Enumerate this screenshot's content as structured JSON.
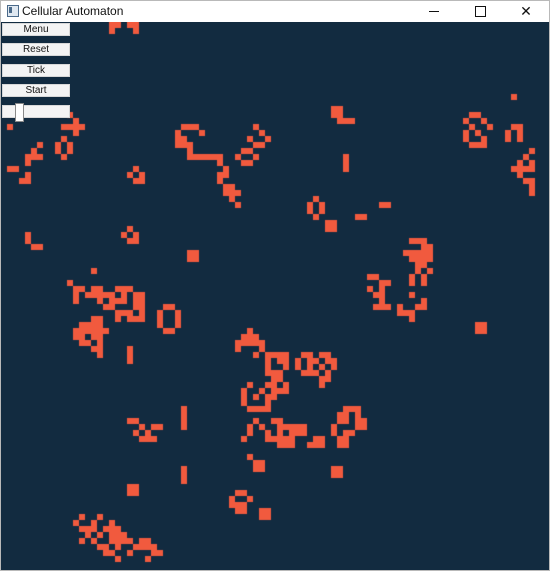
{
  "window": {
    "title": "Cellular Automaton",
    "minimize_icon": "minimize-icon",
    "maximize_icon": "maximize-icon",
    "close_icon": "close-icon",
    "close_glyph": "✕"
  },
  "controls": {
    "menu_label": "Menu",
    "reset_label": "Reset",
    "tick_label": "Tick",
    "start_label": "Start",
    "speed_value": 0.2
  },
  "colors": {
    "background": "#122b40",
    "cell": "#f15a3e"
  },
  "grid": {
    "cell_size_px": 6,
    "live_cells": [
      [
        18,
        0
      ],
      [
        19,
        0
      ],
      [
        21,
        0
      ],
      [
        22,
        0
      ],
      [
        18,
        1
      ],
      [
        22,
        1
      ],
      [
        85,
        12
      ],
      [
        55,
        14
      ],
      [
        56,
        14
      ],
      [
        55,
        15
      ],
      [
        56,
        15
      ],
      [
        56,
        16
      ],
      [
        57,
        16
      ],
      [
        58,
        16
      ],
      [
        1,
        17
      ],
      [
        11,
        15
      ],
      [
        12,
        16
      ],
      [
        10,
        17
      ],
      [
        11,
        17
      ],
      [
        12,
        17
      ],
      [
        13,
        17
      ],
      [
        12,
        18
      ],
      [
        10,
        19
      ],
      [
        9,
        20
      ],
      [
        11,
        20
      ],
      [
        9,
        21
      ],
      [
        11,
        21
      ],
      [
        10,
        22
      ],
      [
        78,
        15
      ],
      [
        79,
        15
      ],
      [
        77,
        16
      ],
      [
        80,
        16
      ],
      [
        78,
        17
      ],
      [
        81,
        17
      ],
      [
        77,
        18
      ],
      [
        79,
        18
      ],
      [
        77,
        19
      ],
      [
        80,
        19
      ],
      [
        78,
        20
      ],
      [
        79,
        20
      ],
      [
        80,
        20
      ],
      [
        85,
        17
      ],
      [
        86,
        17
      ],
      [
        84,
        18
      ],
      [
        86,
        18
      ],
      [
        84,
        19
      ],
      [
        86,
        19
      ],
      [
        30,
        17
      ],
      [
        31,
        17
      ],
      [
        32,
        17
      ],
      [
        29,
        18
      ],
      [
        33,
        18
      ],
      [
        29,
        19
      ],
      [
        30,
        19
      ],
      [
        29,
        20
      ],
      [
        30,
        20
      ],
      [
        31,
        20
      ],
      [
        31,
        21
      ],
      [
        31,
        22
      ],
      [
        32,
        22
      ],
      [
        33,
        22
      ],
      [
        34,
        22
      ],
      [
        35,
        22
      ],
      [
        36,
        22
      ],
      [
        36,
        23
      ],
      [
        37,
        24
      ],
      [
        36,
        25
      ],
      [
        37,
        25
      ],
      [
        36,
        26
      ],
      [
        37,
        27
      ],
      [
        38,
        27
      ],
      [
        37,
        28
      ],
      [
        38,
        28
      ],
      [
        39,
        28
      ],
      [
        38,
        29
      ],
      [
        39,
        30
      ],
      [
        42,
        17
      ],
      [
        43,
        18
      ],
      [
        41,
        19
      ],
      [
        44,
        19
      ],
      [
        42,
        20
      ],
      [
        43,
        20
      ],
      [
        40,
        21
      ],
      [
        41,
        21
      ],
      [
        39,
        22
      ],
      [
        42,
        22
      ],
      [
        40,
        23
      ],
      [
        41,
        23
      ],
      [
        6,
        20
      ],
      [
        5,
        21
      ],
      [
        4,
        22
      ],
      [
        5,
        22
      ],
      [
        6,
        22
      ],
      [
        4,
        23
      ],
      [
        1,
        24
      ],
      [
        2,
        24
      ],
      [
        4,
        25
      ],
      [
        3,
        26
      ],
      [
        4,
        26
      ],
      [
        57,
        22
      ],
      [
        57,
        23
      ],
      [
        57,
        24
      ],
      [
        88,
        21
      ],
      [
        87,
        22
      ],
      [
        86,
        23
      ],
      [
        88,
        23
      ],
      [
        85,
        24
      ],
      [
        86,
        24
      ],
      [
        87,
        24
      ],
      [
        88,
        24
      ],
      [
        86,
        25
      ],
      [
        87,
        26
      ],
      [
        88,
        26
      ],
      [
        88,
        27
      ],
      [
        88,
        28
      ],
      [
        22,
        24
      ],
      [
        21,
        25
      ],
      [
        23,
        25
      ],
      [
        22,
        26
      ],
      [
        23,
        26
      ],
      [
        52,
        29
      ],
      [
        51,
        30
      ],
      [
        53,
        30
      ],
      [
        51,
        31
      ],
      [
        53,
        31
      ],
      [
        52,
        32
      ],
      [
        63,
        30
      ],
      [
        64,
        30
      ],
      [
        59,
        32
      ],
      [
        60,
        32
      ],
      [
        54,
        33
      ],
      [
        55,
        33
      ],
      [
        54,
        34
      ],
      [
        55,
        34
      ],
      [
        4,
        35
      ],
      [
        4,
        36
      ],
      [
        5,
        37
      ],
      [
        6,
        37
      ],
      [
        21,
        34
      ],
      [
        20,
        35
      ],
      [
        22,
        35
      ],
      [
        21,
        36
      ],
      [
        22,
        36
      ],
      [
        31,
        38
      ],
      [
        32,
        38
      ],
      [
        31,
        39
      ],
      [
        32,
        39
      ],
      [
        68,
        36
      ],
      [
        69,
        36
      ],
      [
        70,
        36
      ],
      [
        70,
        37
      ],
      [
        71,
        37
      ],
      [
        67,
        38
      ],
      [
        68,
        38
      ],
      [
        69,
        38
      ],
      [
        70,
        38
      ],
      [
        71,
        38
      ],
      [
        68,
        39
      ],
      [
        69,
        39
      ],
      [
        70,
        39
      ],
      [
        71,
        39
      ],
      [
        69,
        40
      ],
      [
        70,
        40
      ],
      [
        69,
        41
      ],
      [
        71,
        41
      ],
      [
        68,
        42
      ],
      [
        70,
        42
      ],
      [
        68,
        43
      ],
      [
        70,
        43
      ],
      [
        15,
        41
      ],
      [
        11,
        43
      ],
      [
        12,
        44
      ],
      [
        13,
        44
      ],
      [
        15,
        44
      ],
      [
        16,
        44
      ],
      [
        19,
        44
      ],
      [
        20,
        44
      ],
      [
        21,
        44
      ],
      [
        12,
        45
      ],
      [
        14,
        45
      ],
      [
        15,
        45
      ],
      [
        16,
        45
      ],
      [
        17,
        45
      ],
      [
        18,
        45
      ],
      [
        20,
        45
      ],
      [
        22,
        45
      ],
      [
        23,
        45
      ],
      [
        12,
        46
      ],
      [
        16,
        46
      ],
      [
        18,
        46
      ],
      [
        19,
        46
      ],
      [
        20,
        46
      ],
      [
        22,
        46
      ],
      [
        23,
        46
      ],
      [
        17,
        47
      ],
      [
        18,
        47
      ],
      [
        22,
        47
      ],
      [
        23,
        47
      ],
      [
        27,
        47
      ],
      [
        28,
        47
      ],
      [
        19,
        48
      ],
      [
        20,
        48
      ],
      [
        21,
        48
      ],
      [
        23,
        48
      ],
      [
        26,
        48
      ],
      [
        29,
        48
      ],
      [
        15,
        49
      ],
      [
        16,
        49
      ],
      [
        19,
        49
      ],
      [
        21,
        49
      ],
      [
        22,
        49
      ],
      [
        23,
        49
      ],
      [
        26,
        49
      ],
      [
        29,
        49
      ],
      [
        13,
        50
      ],
      [
        14,
        50
      ],
      [
        15,
        50
      ],
      [
        16,
        50
      ],
      [
        26,
        50
      ],
      [
        29,
        50
      ],
      [
        12,
        51
      ],
      [
        13,
        51
      ],
      [
        14,
        51
      ],
      [
        15,
        51
      ],
      [
        16,
        51
      ],
      [
        17,
        51
      ],
      [
        27,
        51
      ],
      [
        28,
        51
      ],
      [
        12,
        52
      ],
      [
        13,
        52
      ],
      [
        15,
        52
      ],
      [
        16,
        52
      ],
      [
        13,
        53
      ],
      [
        14,
        53
      ],
      [
        16,
        53
      ],
      [
        15,
        54
      ],
      [
        16,
        54
      ],
      [
        16,
        55
      ],
      [
        61,
        42
      ],
      [
        62,
        42
      ],
      [
        63,
        43
      ],
      [
        64,
        43
      ],
      [
        61,
        44
      ],
      [
        63,
        44
      ],
      [
        62,
        45
      ],
      [
        63,
        45
      ],
      [
        63,
        46
      ],
      [
        62,
        47
      ],
      [
        63,
        47
      ],
      [
        64,
        47
      ],
      [
        66,
        47
      ],
      [
        66,
        48
      ],
      [
        67,
        48
      ],
      [
        68,
        48
      ],
      [
        68,
        49
      ],
      [
        68,
        45
      ],
      [
        70,
        46
      ],
      [
        69,
        47
      ],
      [
        70,
        47
      ],
      [
        21,
        54
      ],
      [
        21,
        55
      ],
      [
        21,
        56
      ],
      [
        79,
        50
      ],
      [
        80,
        50
      ],
      [
        79,
        51
      ],
      [
        80,
        51
      ],
      [
        41,
        51
      ],
      [
        40,
        52
      ],
      [
        41,
        52
      ],
      [
        42,
        52
      ],
      [
        39,
        53
      ],
      [
        40,
        53
      ],
      [
        41,
        53
      ],
      [
        42,
        53
      ],
      [
        43,
        53
      ],
      [
        39,
        54
      ],
      [
        43,
        54
      ],
      [
        42,
        55
      ],
      [
        44,
        55
      ],
      [
        45,
        55
      ],
      [
        46,
        55
      ],
      [
        47,
        55
      ],
      [
        44,
        56
      ],
      [
        46,
        56
      ],
      [
        47,
        56
      ],
      [
        44,
        57
      ],
      [
        47,
        57
      ],
      [
        44,
        58
      ],
      [
        45,
        58
      ],
      [
        46,
        58
      ],
      [
        45,
        59
      ],
      [
        46,
        59
      ],
      [
        45,
        60
      ],
      [
        47,
        60
      ],
      [
        46,
        61
      ],
      [
        47,
        61
      ],
      [
        50,
        55
      ],
      [
        51,
        55
      ],
      [
        53,
        55
      ],
      [
        54,
        55
      ],
      [
        49,
        56
      ],
      [
        51,
        56
      ],
      [
        52,
        56
      ],
      [
        54,
        56
      ],
      [
        55,
        56
      ],
      [
        49,
        57
      ],
      [
        51,
        57
      ],
      [
        53,
        57
      ],
      [
        55,
        57
      ],
      [
        50,
        58
      ],
      [
        51,
        58
      ],
      [
        52,
        58
      ],
      [
        54,
        58
      ],
      [
        53,
        59
      ],
      [
        54,
        59
      ],
      [
        53,
        60
      ],
      [
        41,
        60
      ],
      [
        44,
        60
      ],
      [
        40,
        61
      ],
      [
        43,
        61
      ],
      [
        45,
        61
      ],
      [
        40,
        62
      ],
      [
        42,
        62
      ],
      [
        44,
        62
      ],
      [
        45,
        62
      ],
      [
        40,
        63
      ],
      [
        44,
        63
      ],
      [
        41,
        64
      ],
      [
        42,
        64
      ],
      [
        43,
        64
      ],
      [
        44,
        64
      ],
      [
        30,
        64
      ],
      [
        30,
        65
      ],
      [
        30,
        66
      ],
      [
        30,
        67
      ],
      [
        57,
        64
      ],
      [
        58,
        64
      ],
      [
        59,
        64
      ],
      [
        56,
        65
      ],
      [
        57,
        65
      ],
      [
        59,
        65
      ],
      [
        56,
        66
      ],
      [
        57,
        66
      ],
      [
        59,
        66
      ],
      [
        60,
        66
      ],
      [
        55,
        67
      ],
      [
        59,
        67
      ],
      [
        60,
        67
      ],
      [
        55,
        68
      ],
      [
        57,
        68
      ],
      [
        58,
        68
      ],
      [
        56,
        69
      ],
      [
        57,
        69
      ],
      [
        56,
        70
      ],
      [
        57,
        70
      ],
      [
        48,
        67
      ],
      [
        49,
        67
      ],
      [
        50,
        67
      ],
      [
        48,
        68
      ],
      [
        49,
        68
      ],
      [
        50,
        68
      ],
      [
        52,
        69
      ],
      [
        53,
        69
      ],
      [
        51,
        70
      ],
      [
        52,
        70
      ],
      [
        53,
        70
      ],
      [
        21,
        66
      ],
      [
        22,
        66
      ],
      [
        23,
        67
      ],
      [
        25,
        67
      ],
      [
        26,
        67
      ],
      [
        22,
        68
      ],
      [
        24,
        68
      ],
      [
        23,
        69
      ],
      [
        24,
        69
      ],
      [
        25,
        69
      ],
      [
        42,
        66
      ],
      [
        45,
        66
      ],
      [
        46,
        66
      ],
      [
        41,
        67
      ],
      [
        43,
        67
      ],
      [
        46,
        67
      ],
      [
        47,
        67
      ],
      [
        41,
        68
      ],
      [
        44,
        68
      ],
      [
        46,
        68
      ],
      [
        48,
        68
      ],
      [
        40,
        69
      ],
      [
        44,
        69
      ],
      [
        45,
        69
      ],
      [
        46,
        69
      ],
      [
        47,
        69
      ],
      [
        48,
        69
      ],
      [
        46,
        70
      ],
      [
        47,
        70
      ],
      [
        48,
        70
      ],
      [
        41,
        72
      ],
      [
        42,
        73
      ],
      [
        43,
        73
      ],
      [
        42,
        74
      ],
      [
        43,
        74
      ],
      [
        30,
        74
      ],
      [
        30,
        75
      ],
      [
        30,
        76
      ],
      [
        21,
        77
      ],
      [
        22,
        77
      ],
      [
        21,
        78
      ],
      [
        22,
        78
      ],
      [
        39,
        78
      ],
      [
        40,
        78
      ],
      [
        38,
        79
      ],
      [
        41,
        79
      ],
      [
        38,
        80
      ],
      [
        39,
        80
      ],
      [
        40,
        80
      ],
      [
        39,
        81
      ],
      [
        40,
        81
      ],
      [
        43,
        81
      ],
      [
        44,
        81
      ],
      [
        43,
        82
      ],
      [
        44,
        82
      ],
      [
        55,
        74
      ],
      [
        56,
        74
      ],
      [
        55,
        75
      ],
      [
        56,
        75
      ],
      [
        13,
        82
      ],
      [
        16,
        82
      ],
      [
        18,
        83
      ],
      [
        12,
        83
      ],
      [
        15,
        83
      ],
      [
        13,
        84
      ],
      [
        14,
        84
      ],
      [
        15,
        84
      ],
      [
        17,
        84
      ],
      [
        18,
        84
      ],
      [
        19,
        84
      ],
      [
        14,
        85
      ],
      [
        16,
        85
      ],
      [
        18,
        85
      ],
      [
        19,
        85
      ],
      [
        20,
        85
      ],
      [
        13,
        86
      ],
      [
        15,
        86
      ],
      [
        18,
        86
      ],
      [
        19,
        86
      ],
      [
        20,
        86
      ],
      [
        21,
        86
      ],
      [
        23,
        86
      ],
      [
        24,
        86
      ],
      [
        16,
        87
      ],
      [
        17,
        87
      ],
      [
        19,
        87
      ],
      [
        22,
        87
      ],
      [
        23,
        87
      ],
      [
        24,
        87
      ],
      [
        25,
        87
      ],
      [
        17,
        88
      ],
      [
        18,
        88
      ],
      [
        21,
        88
      ],
      [
        25,
        88
      ],
      [
        26,
        88
      ],
      [
        19,
        89
      ],
      [
        24,
        89
      ]
    ]
  }
}
